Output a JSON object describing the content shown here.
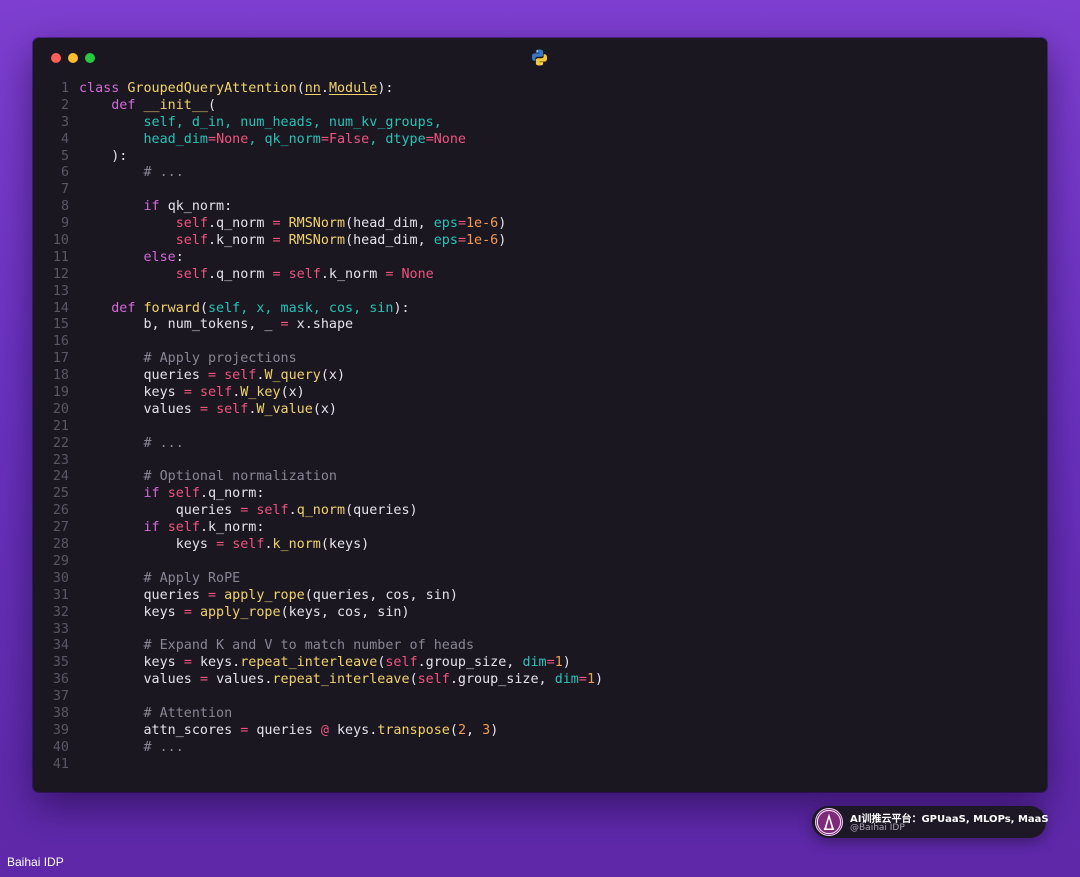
{
  "editor": {
    "language_icon": "python-icon",
    "window_controls": [
      "close",
      "minimize",
      "zoom"
    ],
    "lines": [
      [
        {
          "t": "class ",
          "c": "kw"
        },
        {
          "t": "GroupedQueryAttention",
          "c": "cls"
        },
        {
          "t": "(",
          "c": ""
        },
        {
          "t": "nn",
          "c": "cls ul"
        },
        {
          "t": ".",
          "c": ""
        },
        {
          "t": "Module",
          "c": "cls ul"
        },
        {
          "t": "):",
          "c": ""
        }
      ],
      [
        {
          "t": "    ",
          "c": ""
        },
        {
          "t": "def ",
          "c": "kw"
        },
        {
          "t": "__init__",
          "c": "fn"
        },
        {
          "t": "(",
          "c": ""
        }
      ],
      [
        {
          "t": "        ",
          "c": ""
        },
        {
          "t": "self, d_in, num_heads, num_kv_groups,",
          "c": "par"
        }
      ],
      [
        {
          "t": "        ",
          "c": ""
        },
        {
          "t": "head_dim",
          "c": "par"
        },
        {
          "t": "=",
          "c": "op"
        },
        {
          "t": "None",
          "c": "cnst"
        },
        {
          "t": ", ",
          "c": "par"
        },
        {
          "t": "qk_norm",
          "c": "par"
        },
        {
          "t": "=",
          "c": "op"
        },
        {
          "t": "False",
          "c": "cnst"
        },
        {
          "t": ", ",
          "c": "par"
        },
        {
          "t": "dtype",
          "c": "par"
        },
        {
          "t": "=",
          "c": "op"
        },
        {
          "t": "None",
          "c": "cnst"
        }
      ],
      [
        {
          "t": "    ):",
          "c": ""
        }
      ],
      [
        {
          "t": "        ",
          "c": ""
        },
        {
          "t": "# ...",
          "c": "cmt"
        }
      ],
      [],
      [
        {
          "t": "        ",
          "c": ""
        },
        {
          "t": "if ",
          "c": "kw"
        },
        {
          "t": "qk_norm:",
          "c": ""
        }
      ],
      [
        {
          "t": "            ",
          "c": ""
        },
        {
          "t": "self",
          "c": "slf"
        },
        {
          "t": ".q_norm ",
          "c": ""
        },
        {
          "t": "= ",
          "c": "op"
        },
        {
          "t": "RMSNorm",
          "c": "fn"
        },
        {
          "t": "(head_dim, ",
          "c": ""
        },
        {
          "t": "eps",
          "c": "par"
        },
        {
          "t": "=",
          "c": "op"
        },
        {
          "t": "1e-6",
          "c": "num"
        },
        {
          "t": ")",
          "c": ""
        }
      ],
      [
        {
          "t": "            ",
          "c": ""
        },
        {
          "t": "self",
          "c": "slf"
        },
        {
          "t": ".k_norm ",
          "c": ""
        },
        {
          "t": "= ",
          "c": "op"
        },
        {
          "t": "RMSNorm",
          "c": "fn"
        },
        {
          "t": "(head_dim, ",
          "c": ""
        },
        {
          "t": "eps",
          "c": "par"
        },
        {
          "t": "=",
          "c": "op"
        },
        {
          "t": "1e-6",
          "c": "num"
        },
        {
          "t": ")",
          "c": ""
        }
      ],
      [
        {
          "t": "        ",
          "c": ""
        },
        {
          "t": "else",
          "c": "kw"
        },
        {
          "t": ":",
          "c": ""
        }
      ],
      [
        {
          "t": "            ",
          "c": ""
        },
        {
          "t": "self",
          "c": "slf"
        },
        {
          "t": ".q_norm ",
          "c": ""
        },
        {
          "t": "= ",
          "c": "op"
        },
        {
          "t": "self",
          "c": "slf"
        },
        {
          "t": ".k_norm ",
          "c": ""
        },
        {
          "t": "= ",
          "c": "op"
        },
        {
          "t": "None",
          "c": "cnst"
        }
      ],
      [],
      [
        {
          "t": "    ",
          "c": ""
        },
        {
          "t": "def ",
          "c": "kw"
        },
        {
          "t": "forward",
          "c": "fn"
        },
        {
          "t": "(",
          "c": ""
        },
        {
          "t": "self, x, mask, cos, sin",
          "c": "par"
        },
        {
          "t": "):",
          "c": ""
        }
      ],
      [
        {
          "t": "        b, num_tokens, _ ",
          "c": ""
        },
        {
          "t": "= ",
          "c": "op"
        },
        {
          "t": "x.shape",
          "c": ""
        }
      ],
      [],
      [
        {
          "t": "        ",
          "c": ""
        },
        {
          "t": "# Apply projections",
          "c": "cmt"
        }
      ],
      [
        {
          "t": "        queries ",
          "c": ""
        },
        {
          "t": "= ",
          "c": "op"
        },
        {
          "t": "self",
          "c": "slf"
        },
        {
          "t": ".",
          "c": ""
        },
        {
          "t": "W_query",
          "c": "fn"
        },
        {
          "t": "(x)",
          "c": ""
        }
      ],
      [
        {
          "t": "        keys ",
          "c": ""
        },
        {
          "t": "= ",
          "c": "op"
        },
        {
          "t": "self",
          "c": "slf"
        },
        {
          "t": ".",
          "c": ""
        },
        {
          "t": "W_key",
          "c": "fn"
        },
        {
          "t": "(x)",
          "c": ""
        }
      ],
      [
        {
          "t": "        values ",
          "c": ""
        },
        {
          "t": "= ",
          "c": "op"
        },
        {
          "t": "self",
          "c": "slf"
        },
        {
          "t": ".",
          "c": ""
        },
        {
          "t": "W_value",
          "c": "fn"
        },
        {
          "t": "(x)",
          "c": ""
        }
      ],
      [],
      [
        {
          "t": "        ",
          "c": ""
        },
        {
          "t": "# ...",
          "c": "cmt"
        }
      ],
      [],
      [
        {
          "t": "        ",
          "c": ""
        },
        {
          "t": "# Optional normalization",
          "c": "cmt"
        }
      ],
      [
        {
          "t": "        ",
          "c": ""
        },
        {
          "t": "if ",
          "c": "kw"
        },
        {
          "t": "self",
          "c": "slf"
        },
        {
          "t": ".q_norm:",
          "c": ""
        }
      ],
      [
        {
          "t": "            queries ",
          "c": ""
        },
        {
          "t": "= ",
          "c": "op"
        },
        {
          "t": "self",
          "c": "slf"
        },
        {
          "t": ".",
          "c": ""
        },
        {
          "t": "q_norm",
          "c": "fn"
        },
        {
          "t": "(queries)",
          "c": ""
        }
      ],
      [
        {
          "t": "        ",
          "c": ""
        },
        {
          "t": "if ",
          "c": "kw"
        },
        {
          "t": "self",
          "c": "slf"
        },
        {
          "t": ".k_norm:",
          "c": ""
        }
      ],
      [
        {
          "t": "            keys ",
          "c": ""
        },
        {
          "t": "= ",
          "c": "op"
        },
        {
          "t": "self",
          "c": "slf"
        },
        {
          "t": ".",
          "c": ""
        },
        {
          "t": "k_norm",
          "c": "fn"
        },
        {
          "t": "(keys)",
          "c": ""
        }
      ],
      [],
      [
        {
          "t": "        ",
          "c": ""
        },
        {
          "t": "# Apply RoPE",
          "c": "cmt"
        }
      ],
      [
        {
          "t": "        queries ",
          "c": ""
        },
        {
          "t": "= ",
          "c": "op"
        },
        {
          "t": "apply_rope",
          "c": "fn"
        },
        {
          "t": "(queries, cos, sin)",
          "c": ""
        }
      ],
      [
        {
          "t": "        keys ",
          "c": ""
        },
        {
          "t": "= ",
          "c": "op"
        },
        {
          "t": "apply_rope",
          "c": "fn"
        },
        {
          "t": "(keys, cos, sin)",
          "c": ""
        }
      ],
      [],
      [
        {
          "t": "        ",
          "c": ""
        },
        {
          "t": "# Expand K and V to match number of heads",
          "c": "cmt"
        }
      ],
      [
        {
          "t": "        keys ",
          "c": ""
        },
        {
          "t": "= ",
          "c": "op"
        },
        {
          "t": "keys.",
          "c": ""
        },
        {
          "t": "repeat_interleave",
          "c": "fn"
        },
        {
          "t": "(",
          "c": ""
        },
        {
          "t": "self",
          "c": "slf"
        },
        {
          "t": ".group_size, ",
          "c": ""
        },
        {
          "t": "dim",
          "c": "par"
        },
        {
          "t": "=",
          "c": "op"
        },
        {
          "t": "1",
          "c": "num"
        },
        {
          "t": ")",
          "c": ""
        }
      ],
      [
        {
          "t": "        values ",
          "c": ""
        },
        {
          "t": "= ",
          "c": "op"
        },
        {
          "t": "values.",
          "c": ""
        },
        {
          "t": "repeat_interleave",
          "c": "fn"
        },
        {
          "t": "(",
          "c": ""
        },
        {
          "t": "self",
          "c": "slf"
        },
        {
          "t": ".group_size, ",
          "c": ""
        },
        {
          "t": "dim",
          "c": "par"
        },
        {
          "t": "=",
          "c": "op"
        },
        {
          "t": "1",
          "c": "num"
        },
        {
          "t": ")",
          "c": ""
        }
      ],
      [],
      [
        {
          "t": "        ",
          "c": ""
        },
        {
          "t": "# Attention",
          "c": "cmt"
        }
      ],
      [
        {
          "t": "        attn_scores ",
          "c": ""
        },
        {
          "t": "= ",
          "c": "op"
        },
        {
          "t": "queries ",
          "c": ""
        },
        {
          "t": "@ ",
          "c": "op"
        },
        {
          "t": "keys.",
          "c": ""
        },
        {
          "t": "transpose",
          "c": "fn"
        },
        {
          "t": "(",
          "c": ""
        },
        {
          "t": "2",
          "c": "num"
        },
        {
          "t": ", ",
          "c": ""
        },
        {
          "t": "3",
          "c": "num"
        },
        {
          "t": ")",
          "c": ""
        }
      ],
      [
        {
          "t": "        ",
          "c": ""
        },
        {
          "t": "# ...",
          "c": "cmt"
        }
      ],
      []
    ]
  },
  "badge": {
    "title": "AI训推云平台：GPUaaS, MLOPs, MaaS",
    "handle": "@Baihai IDP",
    "logo_icon": "baihai-logo-icon"
  },
  "watermark": {
    "text": "Baihai IDP"
  },
  "colors": {
    "keyword": "#d16ad8",
    "function": "#f2d36b",
    "self": "#f0547e",
    "parameter": "#27c3b7",
    "number": "#f49b53",
    "comment": "#8a8595",
    "editor_bg": "#1a1720"
  }
}
